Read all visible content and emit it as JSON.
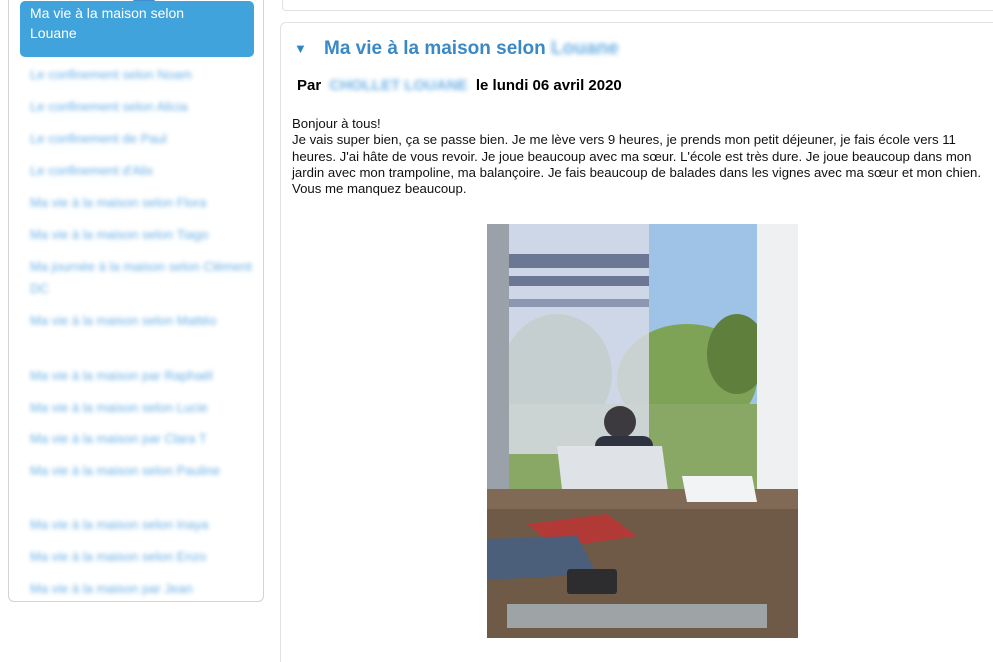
{
  "sidebar": {
    "active_item": "Ma vie à la maison selon\nLouane",
    "items": [
      "Le confinement selon Noam",
      "Le confinement selon Alicia",
      "Le confinement de Paul",
      "Le confinement d'Alix",
      "Ma vie à la maison selon Flora",
      "Ma vie à la maison selon Tiago",
      "Ma journée à la maison selon Clément DC",
      "Ma vie à la maison selon Mattéo",
      "Ma vie à la maison par Raphaël",
      "Ma vie à la maison selon Lucie",
      "Ma vie à la maison par Clara T",
      "Ma vie à la maison selon Pauline",
      "Ma vie à la maison selon Inaya",
      "Ma vie à la maison selon Enzo",
      "Ma vie à la maison par Jean"
    ]
  },
  "post": {
    "toggle_icon": "▼",
    "title_prefix": "Ma vie à la maison selon",
    "title_name": "Louane",
    "byline_prefix": "Par",
    "byline_author": "CHOLLET LOUANE",
    "byline_date": "le lundi 06 avril 2020",
    "greeting": "Bonjour à tous!",
    "body": "Je vais super bien, ça se passe bien. Je me lève vers 9 heures, je prends mon petit déjeuner, je fais école vers 11 heures. J'ai hâte de vous revoir. Je joue beaucoup avec ma sœur. L'école est très dure. Je joue beaucoup dans mon jardin avec mon trampoline, ma balançoire. Je fais beaucoup de balades dans les vignes avec ma sœur et mon chien. Vous me manquez beaucoup."
  },
  "colors": {
    "accent": "#41a3dc",
    "title": "#3a88c6",
    "link": "#5aa7e2"
  }
}
